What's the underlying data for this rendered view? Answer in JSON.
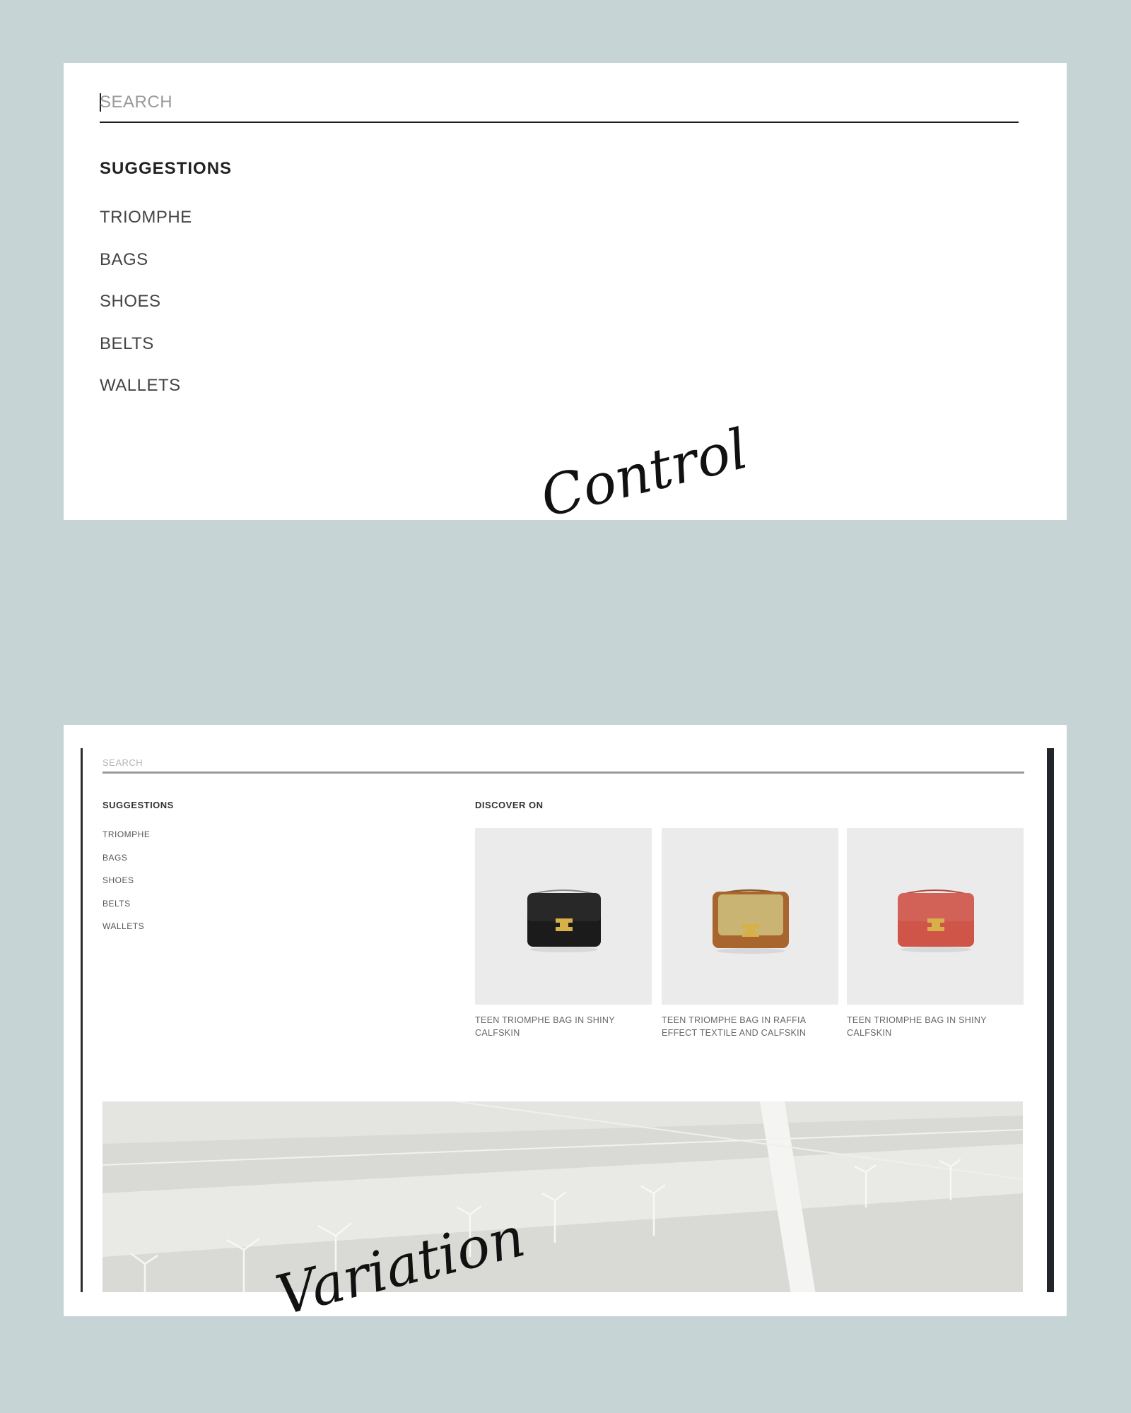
{
  "control": {
    "caption": "Control",
    "search": {
      "placeholder": "SEARCH",
      "value": ""
    },
    "suggestions": {
      "title": "SUGGESTIONS",
      "items": [
        "TRIOMPHE",
        "BAGS",
        "SHOES",
        "BELTS",
        "WALLETS"
      ]
    }
  },
  "variation": {
    "caption": "Variation",
    "search": {
      "placeholder": "SEARCH",
      "value": ""
    },
    "suggestions": {
      "title": "SUGGESTIONS",
      "items": [
        "TRIOMPHE",
        "BAGS",
        "SHOES",
        "BELTS",
        "WALLETS"
      ]
    },
    "discover": {
      "title": "DISCOVER ON",
      "products": [
        {
          "name": "TEEN TRIOMPHE BAG IN SHINY CALFSKIN",
          "color": "#1b1b1b",
          "icon": "bag-black"
        },
        {
          "name": "TEEN TRIOMPHE BAG IN RAFFIA EFFECT TEXTILE AND CALFSKIN",
          "color": "#c9b474",
          "icon": "bag-raffia"
        },
        {
          "name": "TEEN TRIOMPHE BAG IN SHINY CALFSKIN",
          "color": "#cf5549",
          "icon": "bag-red"
        }
      ]
    },
    "banner": {
      "icon": "wind-farm-landscape-image"
    }
  },
  "colors": {
    "background": "#c6d4d5",
    "panel": "#ffffff",
    "text": "#222222",
    "product_bg": "#ebebeb",
    "clasp_gold": "#d8b04a"
  }
}
